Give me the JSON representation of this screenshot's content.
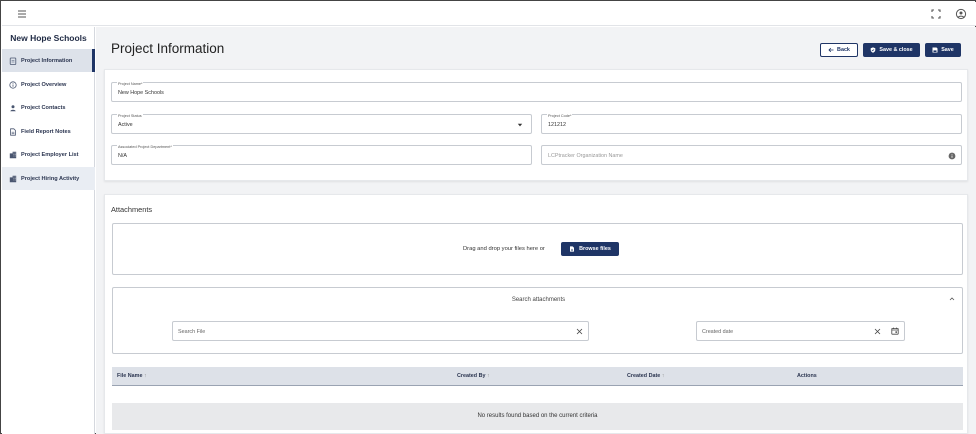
{
  "topbar": {
    "menu_icon": "hamburger-icon",
    "fullscreen_icon": "fullscreen-icon",
    "account_icon": "account-circle-icon"
  },
  "sidebar": {
    "title": "New Hope Schools",
    "items": [
      {
        "label": "Project Information",
        "icon": "clipboard-icon",
        "state": "active"
      },
      {
        "label": "Project Overview",
        "icon": "info-icon",
        "state": "normal"
      },
      {
        "label": "Project Contacts",
        "icon": "person-icon",
        "state": "normal"
      },
      {
        "label": "Field Report Notes",
        "icon": "document-icon",
        "state": "normal"
      },
      {
        "label": "Project Employer List",
        "icon": "building-icon",
        "state": "normal"
      },
      {
        "label": "Project Hiring Activity",
        "icon": "building-icon",
        "state": "highlight"
      }
    ]
  },
  "header": {
    "title": "Project Information",
    "back_label": "Back",
    "save_close_label": "Save & close",
    "save_label": "Save"
  },
  "form": {
    "project_name": {
      "label": "Project Name*",
      "value": "New Hope Schools"
    },
    "project_status": {
      "label": "Project Status",
      "value": "Active"
    },
    "project_code": {
      "label": "Project Code*",
      "value": "121212"
    },
    "department": {
      "label": "Associated Project Department*",
      "value": "N/A"
    },
    "lcp_org": {
      "placeholder": "LCPtracker Organization Name"
    }
  },
  "attachments": {
    "title": "Attachments",
    "drop_text": "Drag and drop your files here or",
    "browse_label": "Browse files",
    "search_title": "Search attachments",
    "search_file_placeholder": "Search File",
    "created_date_placeholder": "Created date",
    "columns": [
      "File Name",
      "Created By",
      "Created Date",
      "Actions"
    ],
    "empty_text": "No results found based on the current criteria"
  },
  "colors": {
    "primary": "#1f3566",
    "sidebar_active": "#dde2ea",
    "background": "#f2f3f5"
  }
}
